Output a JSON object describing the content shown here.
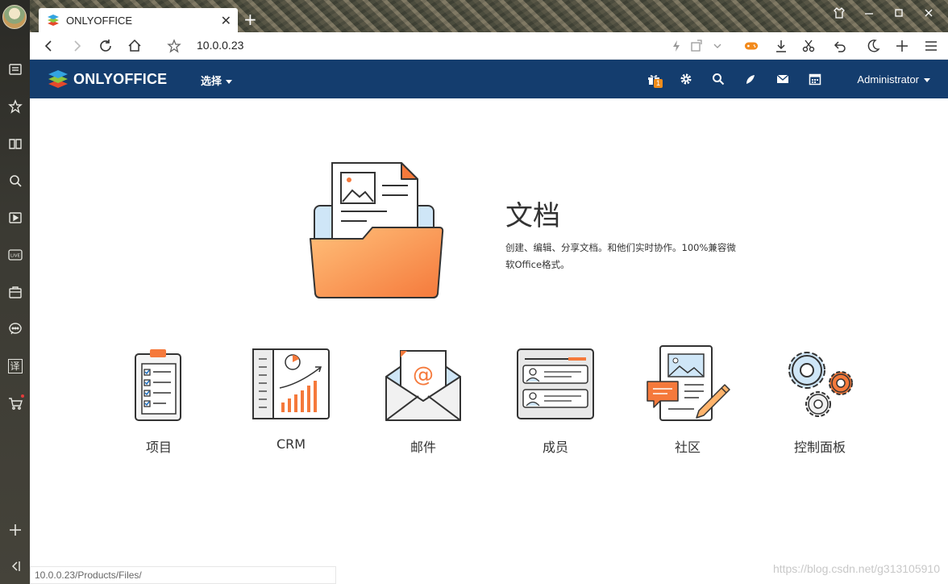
{
  "browser": {
    "tab_title": "ONLYOFFICE",
    "new_tab_symbol": "+",
    "close_symbol": "✕",
    "url": "10.0.0.23",
    "status_url": "10.0.0.23/Products/Files/"
  },
  "sidebar": {
    "icons": [
      "news-icon",
      "star-icon",
      "book-icon",
      "search-icon",
      "video-icon",
      "live-icon",
      "bag-icon",
      "chat-icon",
      "translate-icon",
      "cart-icon",
      "add-icon",
      "collapse-icon"
    ],
    "live_label": "LIVE",
    "translate_label": "译"
  },
  "header": {
    "brand": "ONLYOFFICE",
    "select_label": "选择",
    "gift_badge": "1",
    "user": "Administrator",
    "bg_color": "#143d6e"
  },
  "hero": {
    "title": "文档",
    "description": "创建、编辑、分享文档。和他们实时协作。100%兼容微软Office格式。"
  },
  "modules": [
    {
      "label": "项目"
    },
    {
      "label": "CRM"
    },
    {
      "label": "邮件"
    },
    {
      "label": "成员"
    },
    {
      "label": "社区"
    },
    {
      "label": "控制面板"
    }
  ],
  "watermark": "https://blog.csdn.net/g313105910",
  "colors": {
    "accent": "#f5793b",
    "accent_light": "#ffb36b"
  }
}
